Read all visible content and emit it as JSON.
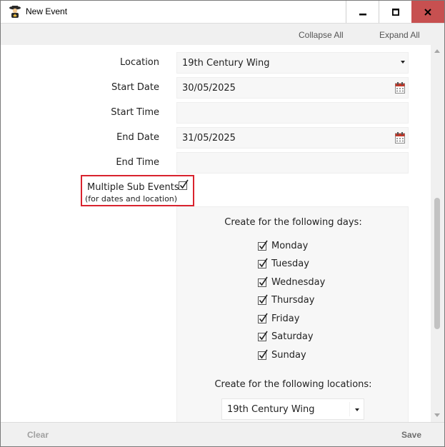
{
  "window": {
    "title": "New Event",
    "accent": "#c75050"
  },
  "toolbar": {
    "collapse_label": "Collapse All",
    "expand_label": "Expand All"
  },
  "form": {
    "location": {
      "label": "Location",
      "value": "19th Century Wing"
    },
    "start_date": {
      "label": "Start Date",
      "value": "30/05/2025"
    },
    "start_time": {
      "label": "Start Time",
      "value": ""
    },
    "end_date": {
      "label": "End Date",
      "value": "31/05/2025"
    },
    "end_time": {
      "label": "End Time",
      "value": ""
    },
    "multiple_sub_events": {
      "label": "Multiple Sub Events",
      "note": "(for dates and location)",
      "checked": true,
      "highlight_color": "#d9232e"
    }
  },
  "sub_events": {
    "days_heading": "Create for the following days:",
    "days": [
      {
        "label": "Monday",
        "checked": true
      },
      {
        "label": "Tuesday",
        "checked": true
      },
      {
        "label": "Wednesday",
        "checked": true
      },
      {
        "label": "Thursday",
        "checked": true
      },
      {
        "label": "Friday",
        "checked": true
      },
      {
        "label": "Saturday",
        "checked": true
      },
      {
        "label": "Sunday",
        "checked": true
      }
    ],
    "locations_heading": "Create for the following locations:",
    "location_value": "19th Century Wing"
  },
  "footer": {
    "clear_label": "Clear",
    "save_label": "Save"
  },
  "icons": {
    "app": "sheriff-figure-icon",
    "calendar": "calendar-icon",
    "dropdown": "chevron-down-icon",
    "checkbox": "checkbox-checked-icon"
  }
}
